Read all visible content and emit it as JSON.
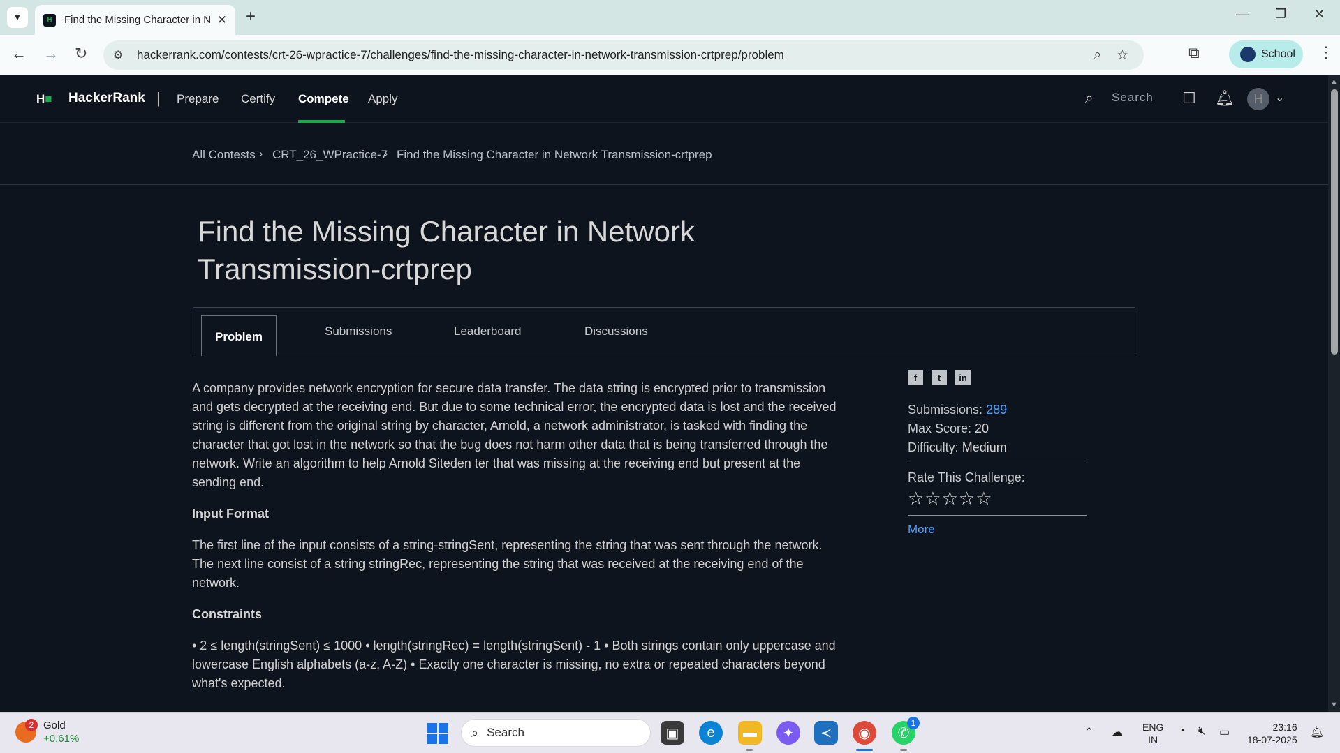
{
  "browser": {
    "tab_title": "Find the Missing Character in N",
    "url": "hackerrank.com/contests/crt-26-wpractice-7/challenges/find-the-missing-character-in-network-transmission-crtprep/problem",
    "profile_label": "School"
  },
  "header": {
    "logo": "H",
    "brand": "HackerRank",
    "separator": "|",
    "nav": [
      "Prepare",
      "Certify",
      "Compete",
      "Apply"
    ],
    "active_nav": "Compete",
    "search_placeholder": "Search"
  },
  "breadcrumb": [
    "All Contests",
    "CRT_26_WPractice-7",
    "Find the Missing Character in Network Transmission-crtprep"
  ],
  "challenge": {
    "title": "Find the Missing Character in Network Transmission-crtprep",
    "tabs": [
      "Problem",
      "Submissions",
      "Leaderboard",
      "Discussions"
    ],
    "active_tab": "Problem",
    "description": "A company provides network encryption for secure data transfer. The data string is encrypted prior to transmission and gets decrypted at the receiving end. But due to some technical error, the encrypted data is lost and the received string is different from the original string by character, Arnold, a network administrator, is tasked with finding the character that got lost in the network so that the bug does not harm other data that is being transferred through the network. Write an algorithm to help Arnold Siteden ter that was missing at the receiving end but present at the sending end.",
    "input_format_heading": "Input Format",
    "input_format": "The first line of the input consists of a string-stringSent, representing the string that was sent through the network. The next line consist of a string stringRec, representing the string that was received at the receiving end of the network.",
    "constraints_heading": "Constraints",
    "constraints": "• 2 ≤ length(stringSent) ≤ 1000 • length(stringRec) = length(stringSent) - 1 • Both strings contain only uppercase and lowercase English alphabets (a-z, A-Z) • Exactly one character is missing, no extra or repeated characters beyond what's expected."
  },
  "sidebar": {
    "social": [
      "f",
      "t",
      "in"
    ],
    "submissions_label": "Submissions:",
    "submissions_value": "289",
    "max_score_label": "Max Score:",
    "max_score_value": "20",
    "difficulty_label": "Difficulty:",
    "difficulty_value": "Medium",
    "rate_label": "Rate This Challenge:",
    "stars": "☆☆☆☆☆",
    "more_link": "More"
  },
  "taskbar": {
    "weather_badge": "2",
    "weather_title": "Gold",
    "weather_change": "+0.61%",
    "search_placeholder": "Search",
    "lang_top": "ENG",
    "lang_bottom": "IN",
    "time": "23:16",
    "date": "18-07-2025",
    "whatsapp_badge": "1"
  },
  "colors": {
    "page_bg": "#0e141e",
    "accent_green": "#1ba94c",
    "link_blue": "#4aa3ff"
  }
}
